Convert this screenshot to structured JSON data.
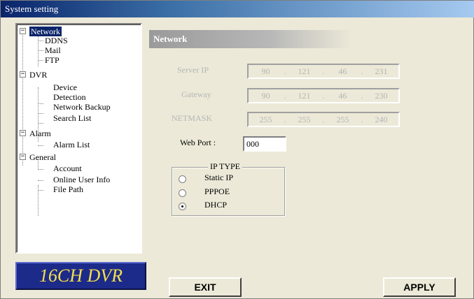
{
  "window": {
    "title": "System setting"
  },
  "tree": {
    "network": "Network",
    "ddns": "DDNS",
    "mail": "Mail",
    "ftp": "FTP",
    "dvr": "DVR",
    "device": "Device",
    "detection": "Detection",
    "network_backup": "Network Backup",
    "search_list": "Search List",
    "alarm": "Alarm",
    "alarm_list": "Alarm List",
    "general": "General",
    "account": "Account",
    "online_user_info": "Online User Info",
    "file_path": "File Path",
    "expander_symbol": "−"
  },
  "logo": {
    "text": "16CH DVR"
  },
  "panel": {
    "title": "Network",
    "ip": {
      "label": "Server IP",
      "octets": [
        "90",
        "121",
        "46",
        "231"
      ]
    },
    "gateway": {
      "label": "Gateway",
      "octets": [
        "90",
        "121",
        "46",
        "230"
      ]
    },
    "netmask": {
      "label": "NETMASK",
      "octets": [
        "255",
        "255",
        "255",
        "240"
      ]
    },
    "web_port": {
      "label": "Web Port :",
      "value": "000"
    },
    "ip_type": {
      "legend": "IP TYPE",
      "options": [
        "Static IP",
        "PPPOE",
        "DHCP"
      ],
      "selected": "DHCP"
    }
  },
  "buttons": {
    "exit": "EXIT",
    "apply": "APPLY"
  },
  "colors": {
    "title_bar": "#0a246a",
    "logo_bg": "#1c2a8a",
    "logo_text": "#f4e04a",
    "selected": "#0a246a"
  }
}
